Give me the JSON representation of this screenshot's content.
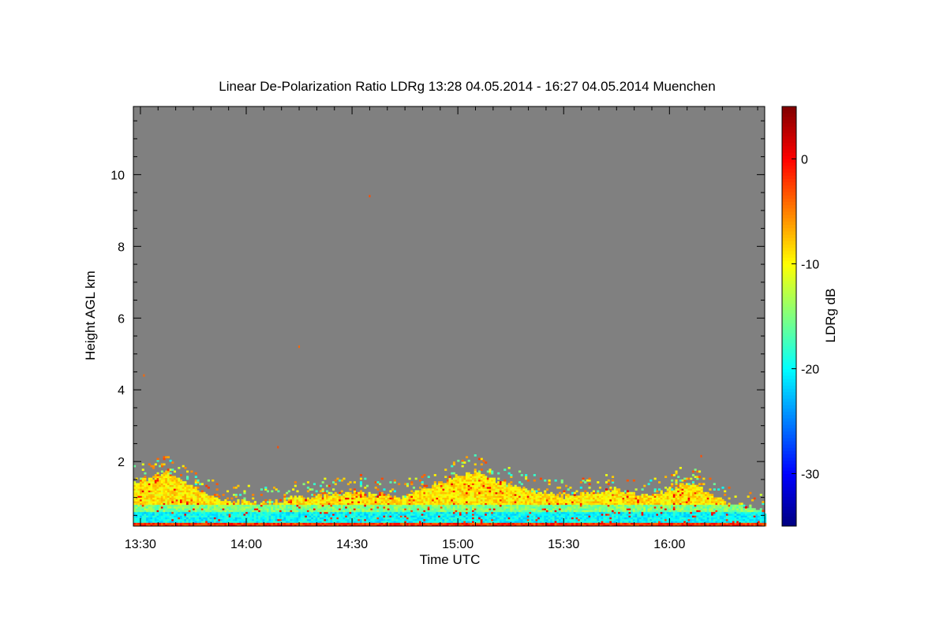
{
  "chart_data": {
    "type": "heatmap",
    "title": "Linear De-Polarization Ratio LDRg   13:28 04.05.2014 - 16:27 04.05.2014 Muenchen",
    "xlabel": "Time UTC",
    "ylabel": "Height AGL km",
    "colorbar_label": "LDRg dB",
    "xlim": [
      "13:28",
      "16:27"
    ],
    "ylim": [
      0.2,
      11.9
    ],
    "x_ticks": [
      "13:30",
      "14:00",
      "14:30",
      "15:00",
      "15:30",
      "16:00"
    ],
    "y_ticks": [
      2,
      4,
      6,
      8,
      10
    ],
    "colorbar_range": [
      -35,
      5
    ],
    "colorbar_ticks": [
      0,
      -10,
      -20,
      -30
    ],
    "background_color": "#808080",
    "colormap": "jet",
    "signal_top_profile_km": [
      {
        "time": "13:28",
        "top": 1.4
      },
      {
        "time": "13:38",
        "top": 1.7
      },
      {
        "time": "13:45",
        "top": 1.3
      },
      {
        "time": "13:52",
        "top": 0.9
      },
      {
        "time": "14:05",
        "top": 0.8
      },
      {
        "time": "14:15",
        "top": 1.0
      },
      {
        "time": "14:30",
        "top": 1.1
      },
      {
        "time": "14:45",
        "top": 1.0
      },
      {
        "time": "14:55",
        "top": 1.4
      },
      {
        "time": "15:05",
        "top": 1.7
      },
      {
        "time": "15:15",
        "top": 1.3
      },
      {
        "time": "15:30",
        "top": 1.0
      },
      {
        "time": "15:45",
        "top": 1.2
      },
      {
        "time": "15:55",
        "top": 1.0
      },
      {
        "time": "16:05",
        "top": 1.4
      },
      {
        "time": "16:15",
        "top": 0.9
      },
      {
        "time": "16:27",
        "top": 0.6
      }
    ],
    "ldr_layers_db": [
      {
        "height_range_km": [
          0.2,
          0.3
        ],
        "ldr": -2
      },
      {
        "height_range_km": [
          0.3,
          0.55
        ],
        "ldr": -20
      },
      {
        "height_range_km": [
          0.55,
          0.8
        ],
        "ldr": -15
      },
      {
        "height_range_km": [
          0.8,
          1.7
        ],
        "ldr": -9
      }
    ],
    "isolated_points": [
      {
        "time": "14:35",
        "height": 9.4,
        "ldr": -3
      },
      {
        "time": "14:15",
        "height": 5.2,
        "ldr": -4
      },
      {
        "time": "13:31",
        "height": 4.4,
        "ldr": -4
      },
      {
        "time": "14:09",
        "height": 2.4,
        "ldr": -3
      },
      {
        "time": "16:09",
        "height": 2.15,
        "ldr": -3
      }
    ]
  }
}
